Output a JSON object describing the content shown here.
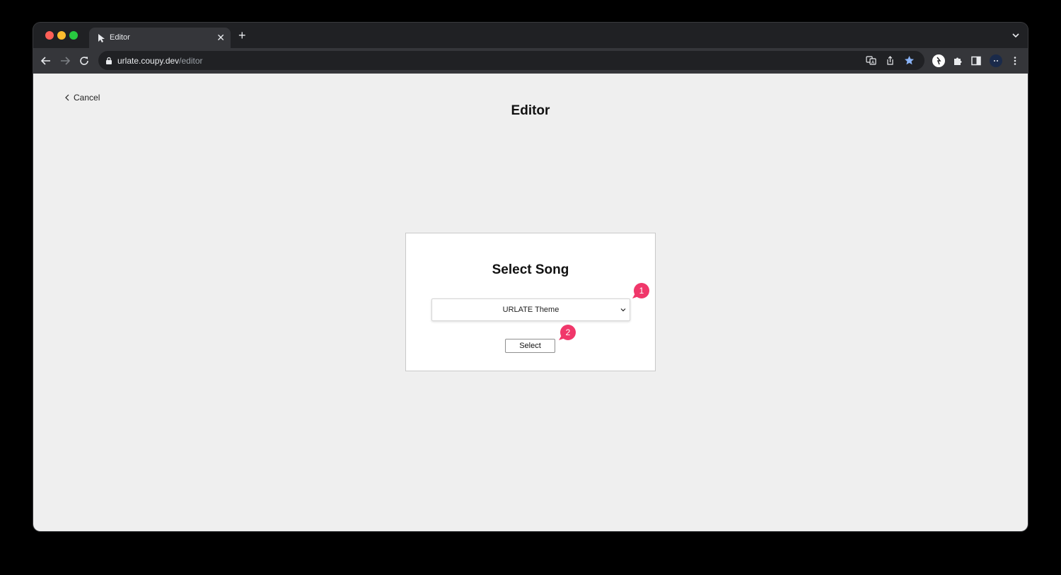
{
  "browser": {
    "tab": {
      "title": "Editor"
    },
    "url": {
      "host": "urlate.coupy.dev",
      "path": "/editor"
    }
  },
  "page": {
    "cancel_label": "Cancel",
    "title": "Editor",
    "dialog": {
      "title": "Select Song",
      "song_select": {
        "selected": "URLATE Theme"
      },
      "select_button": "Select"
    }
  },
  "annotations": [
    {
      "number": "1"
    },
    {
      "number": "2"
    }
  ],
  "colors": {
    "annotation": "#f0376a",
    "page_background": "#efefef",
    "accent_star": "#8ab4f8"
  }
}
